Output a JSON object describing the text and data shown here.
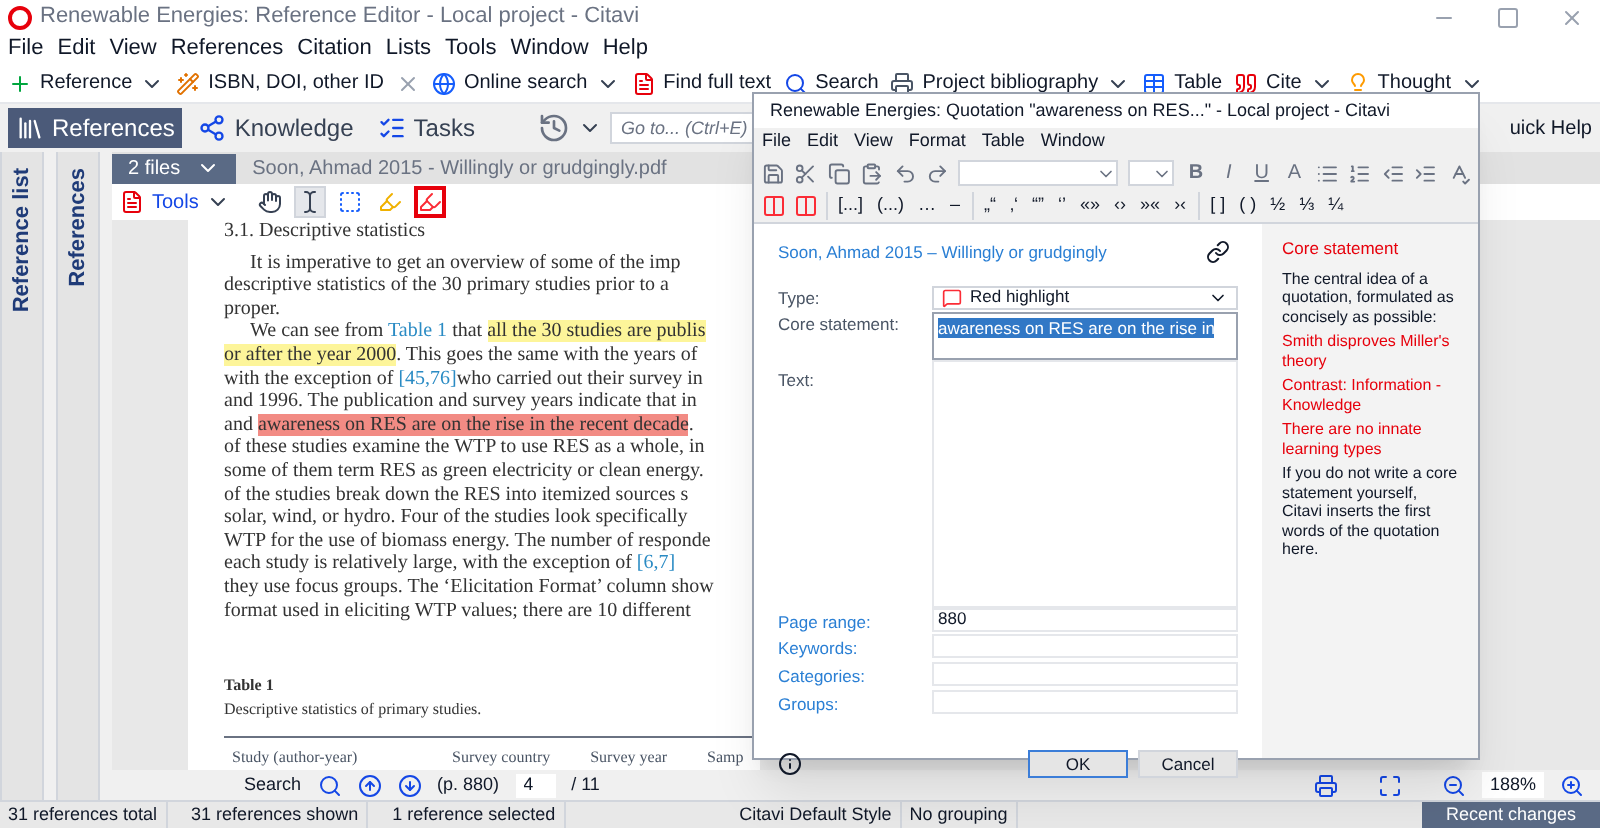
{
  "window": {
    "title": "Renewable Energies: Reference Editor - Local project - Citavi"
  },
  "menu": [
    "File",
    "Edit",
    "View",
    "References",
    "Citation",
    "Lists",
    "Tools",
    "Window",
    "Help"
  ],
  "toolbar": [
    {
      "label": "Reference",
      "kind": "add",
      "dropdown": true
    },
    {
      "label": "ISBN, DOI, other ID",
      "kind": "wand",
      "dropdown": false
    },
    {
      "kind": "delete",
      "dropdown": false
    },
    {
      "label": "Online search",
      "kind": "globe",
      "dropdown": true
    },
    {
      "label": "Find full text",
      "kind": "pdf",
      "dropdown": false
    },
    {
      "label": "Search",
      "kind": "search",
      "dropdown": false
    },
    {
      "label": "Project bibliography",
      "kind": "print",
      "dropdown": true
    },
    {
      "label": "Table",
      "kind": "table",
      "dropdown": false
    },
    {
      "label": "Cite",
      "kind": "cite",
      "dropdown": true
    },
    {
      "label": "Thought",
      "kind": "thought",
      "dropdown": true
    }
  ],
  "nav_tabs": [
    {
      "label": "References",
      "kind": "references",
      "selected": true
    },
    {
      "label": "Knowledge",
      "kind": "knowledge",
      "selected": false
    },
    {
      "label": "Tasks",
      "kind": "tasks",
      "selected": false
    }
  ],
  "goto": {
    "placeholder": "Go to... (Ctrl+E)"
  },
  "quick_help": "uick Help",
  "side_panels": [
    "Reference list",
    "References"
  ],
  "pdf": {
    "files_button": "2 files",
    "file_name": "Soon, Ahmad 2015 - Willingly or grudgingly.pdf",
    "tools_label": "Tools",
    "tools": [
      {
        "kind": "hand",
        "selected": false
      },
      {
        "kind": "select",
        "selected": true
      },
      {
        "kind": "area",
        "selected": false
      },
      {
        "kind": "yellow",
        "selected": false
      },
      {
        "kind": "red",
        "selected": true
      }
    ],
    "heading": "3.1. Descriptive statistics",
    "lines": [
      {
        "indent": true,
        "segments": [
          {
            "kind": "plain",
            "text": "It is imperative to get an overview of some of the imp"
          }
        ]
      },
      {
        "indent": false,
        "segments": [
          {
            "kind": "plain",
            "text": "descriptive statistics of the 30 primary studies prior to a"
          }
        ]
      },
      {
        "indent": false,
        "segments": [
          {
            "kind": "plain",
            "text": "proper."
          }
        ]
      },
      {
        "indent": true,
        "segments": [
          {
            "kind": "plain",
            "text": "We can see from "
          },
          {
            "kind": "link",
            "text": "Table 1"
          },
          {
            "kind": "plain",
            "text": " that "
          },
          {
            "kind": "yellow",
            "text": "all the 30 studies are publis"
          }
        ]
      },
      {
        "indent": false,
        "segments": [
          {
            "kind": "yellow",
            "text": "or after the year 2000"
          },
          {
            "kind": "plain",
            "text": ". This goes the same with the years of"
          }
        ]
      },
      {
        "indent": false,
        "segments": [
          {
            "kind": "plain",
            "text": "with the exception of "
          },
          {
            "kind": "link",
            "text": "[45,76]"
          },
          {
            "kind": "plain",
            "text": "who carried out their survey in"
          }
        ]
      },
      {
        "indent": false,
        "segments": [
          {
            "kind": "plain",
            "text": "and 1996. The publication and survey years indicate that in"
          }
        ]
      },
      {
        "indent": false,
        "segments": [
          {
            "kind": "plain",
            "text": "and "
          },
          {
            "kind": "red",
            "text": "awareness on RES are on the rise in the recent decade"
          },
          {
            "kind": "plain",
            "text": "."
          }
        ]
      },
      {
        "indent": false,
        "segments": [
          {
            "kind": "plain",
            "text": "of these studies examine the WTP to use RES as a whole, in"
          }
        ]
      },
      {
        "indent": false,
        "segments": [
          {
            "kind": "plain",
            "text": "some of them term RES as green electricity or clean energy."
          }
        ]
      },
      {
        "indent": false,
        "segments": [
          {
            "kind": "plain",
            "text": "of the studies break down the RES into itemized sources s"
          }
        ]
      },
      {
        "indent": false,
        "segments": [
          {
            "kind": "plain",
            "text": "solar, wind, or hydro. Four of the studies look specifically"
          }
        ]
      },
      {
        "indent": false,
        "segments": [
          {
            "kind": "plain",
            "text": "WTP for the use of biomass energy. The number of responde"
          }
        ]
      },
      {
        "indent": false,
        "segments": [
          {
            "kind": "plain",
            "text": "each study is relatively large, with the exception of "
          },
          {
            "kind": "link",
            "text": "[6,7]"
          }
        ]
      },
      {
        "indent": false,
        "segments": [
          {
            "kind": "plain",
            "text": "they use focus groups. The ‘Elicitation Format’ column show"
          }
        ]
      },
      {
        "indent": false,
        "segments": [
          {
            "kind": "plain",
            "text": "format used in eliciting WTP values; there are 10 different"
          }
        ]
      }
    ],
    "table_title": "Table 1",
    "table_caption": "Descriptive statistics of primary studies.",
    "table_columns": [
      "Study (author-year)",
      "Survey country",
      "Survey year",
      "Samp"
    ]
  },
  "search_bar": {
    "label": "Search",
    "page_label": "(p. 880)",
    "page": "4",
    "total": "/ 11",
    "zoom": "188%"
  },
  "status_bar": [
    "31 references total",
    "31 references shown",
    "1 reference selected",
    "Citavi Default Style",
    "No grouping"
  ],
  "recent_changes": "Recent changes",
  "dialog": {
    "title": "Renewable Energies: Quotation \"awareness on RES...\" - Local project - Citavi",
    "menu": [
      "File",
      "Edit",
      "View",
      "Format",
      "Table",
      "Window"
    ],
    "format_buttons": [
      "B",
      "I",
      "U",
      "A"
    ],
    "symbols": [
      [
        "[...]",
        "(...)",
        "…",
        "–"
      ],
      [
        "„“",
        "‚‘",
        "“”",
        "‘’",
        "«»",
        "‹›",
        "»«",
        "›‹"
      ],
      [
        "[ ]",
        "( )",
        "½",
        "⅓",
        "¼"
      ]
    ],
    "reference": "Soon, Ahmad 2015 – Willingly or grudgingly",
    "type_label": "Type:",
    "type_value": "Red highlight",
    "core_label": "Core statement:",
    "core_value": "awareness on RES are on the rise in",
    "text_label": "Text:",
    "fields": [
      {
        "label": "Page range:",
        "value": "880"
      },
      {
        "label": "Keywords:"
      },
      {
        "label": "Categories:"
      },
      {
        "label": "Groups:"
      }
    ],
    "ok": "OK",
    "cancel": "Cancel",
    "help": {
      "title": "Core statement",
      "intro": "The central idea of a quotation, formulated as concisely as possible:",
      "examples": [
        "Smith disproves Miller's theory",
        "Contrast: Information - Knowledge",
        "There are no innate learning types"
      ],
      "note": "If you do not write a core statement yourself, Citavi inserts the first words of the quotation here."
    }
  }
}
